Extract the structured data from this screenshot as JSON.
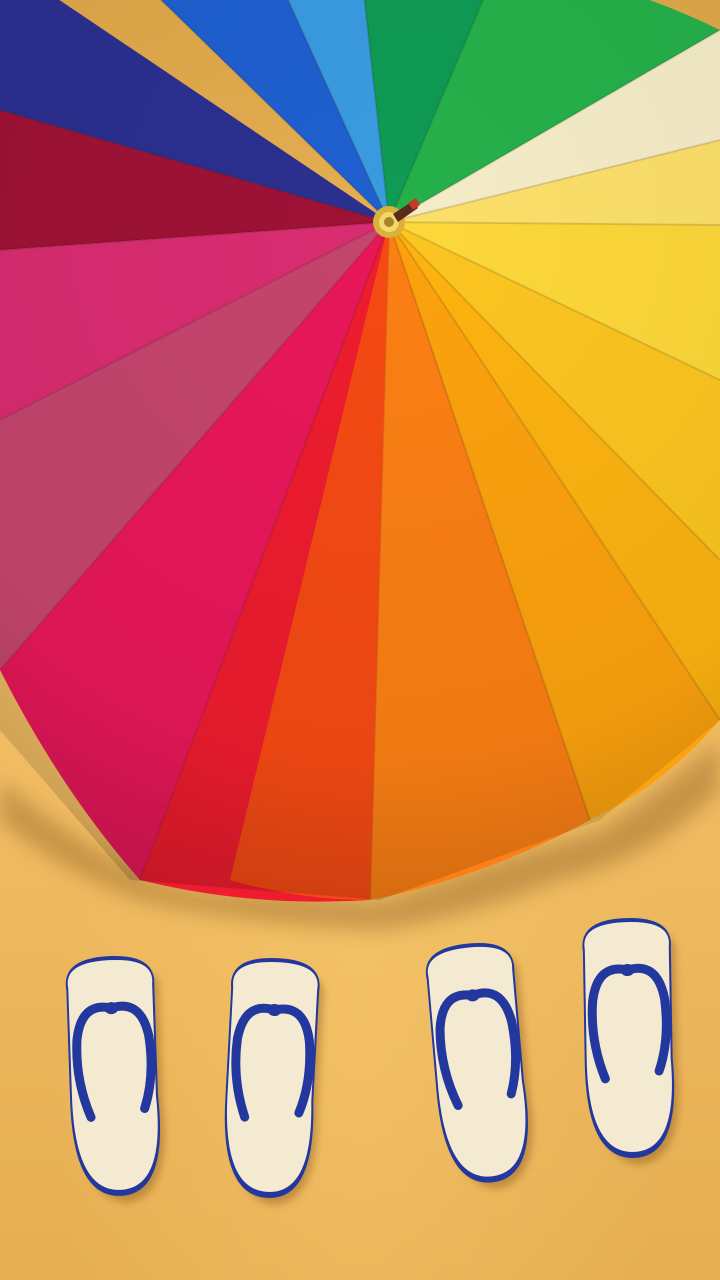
{
  "scene": {
    "umbrella_panel_colors": [
      "#2b2f8f",
      "#1e5fcf",
      "#3a9be0",
      "#0f9a55",
      "#25b04a",
      "#f5ecc8",
      "#fce06a",
      "#fdd83a",
      "#fcc520",
      "#fdb310",
      "#fca20e",
      "#fb7f14",
      "#f54a14",
      "#ee1c2e",
      "#e8175a",
      "#c4456d",
      "#d92c70",
      "#9e1236"
    ],
    "sand_color": "#e9b24e",
    "flipflop_sole_color": "#f4ead2",
    "flipflop_strap_color": "#23389e",
    "flipflop_count": 4
  }
}
